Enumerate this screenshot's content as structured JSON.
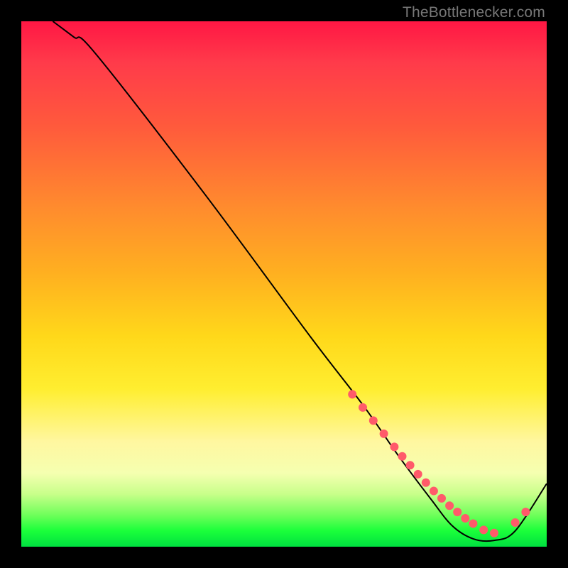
{
  "watermark_text": "TheBottlenecker.com",
  "chart_data": {
    "type": "line",
    "title": "",
    "xlabel": "",
    "ylabel": "",
    "xlim": [
      0,
      100
    ],
    "ylim": [
      0,
      100
    ],
    "curve": {
      "x": [
        6,
        10,
        14,
        35,
        55,
        65,
        72,
        78,
        82,
        86,
        90,
        94,
        100
      ],
      "y": [
        100,
        97,
        94,
        67,
        40,
        27,
        17,
        9,
        4,
        1.5,
        1.2,
        3,
        12
      ]
    },
    "markers": {
      "x": [
        63,
        65,
        67,
        69,
        71,
        72.5,
        74,
        75.5,
        77,
        78.5,
        80,
        81.5,
        83,
        84.5,
        86,
        88,
        90,
        94,
        96
      ],
      "y": [
        29,
        26.5,
        24,
        21.5,
        19,
        17.2,
        15.5,
        13.8,
        12.2,
        10.6,
        9.2,
        7.8,
        6.6,
        5.4,
        4.4,
        3.2,
        2.6,
        4.6,
        6.6
      ],
      "color": "#ff5a6a",
      "radius": 6
    },
    "curve_color": "#000000",
    "curve_width": 2
  }
}
